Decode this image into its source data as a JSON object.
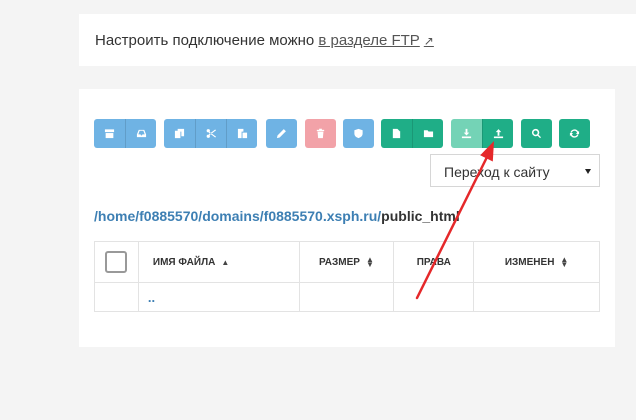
{
  "ftp_notice": {
    "text": "Настроить подключение можно",
    "link_text": "в разделе FTP",
    "link_icon": "external-link-icon"
  },
  "toolbar": {
    "groups": [
      {
        "color": "#6fb3e4",
        "buttons": [
          "archive-icon",
          "inbox-icon"
        ]
      },
      {
        "color": "#6fb3e4",
        "buttons": [
          "copy-icon",
          "scissors-icon",
          "paste-icon"
        ]
      },
      {
        "color": "#6fb3e4",
        "buttons": [
          "pencil-icon"
        ]
      },
      {
        "color": "#f2a2a8",
        "buttons": [
          "trash-icon"
        ]
      },
      {
        "color": "#6fb3e4",
        "buttons": [
          "shield-icon"
        ]
      },
      {
        "color": "#1fae87",
        "buttons": [
          "new-file-icon",
          "new-folder-icon"
        ]
      },
      {
        "color": "#74d3b6",
        "buttons": [
          "download-icon"
        ]
      },
      {
        "color": "#1fae87",
        "buttons": [
          "upload-icon"
        ]
      },
      {
        "color": "#1fae87",
        "buttons": [
          "search-icon"
        ]
      },
      {
        "color": "#1fae87",
        "buttons": [
          "refresh-icon"
        ]
      }
    ]
  },
  "site_select": {
    "label": "Переход к сайту"
  },
  "path": {
    "segments": [
      "/home/",
      "f0885570",
      "/",
      "domains",
      "/",
      "f0885570.xsph.ru",
      "/"
    ],
    "current": "public_html"
  },
  "table": {
    "columns": {
      "name": "Имя файла",
      "size": "Размер",
      "perms": "Права",
      "modified": "Изменен"
    },
    "rows": [
      {
        "name": "..",
        "size": "",
        "perms": "",
        "modified": ""
      }
    ]
  },
  "annotation": {
    "color": "#e5282a"
  }
}
